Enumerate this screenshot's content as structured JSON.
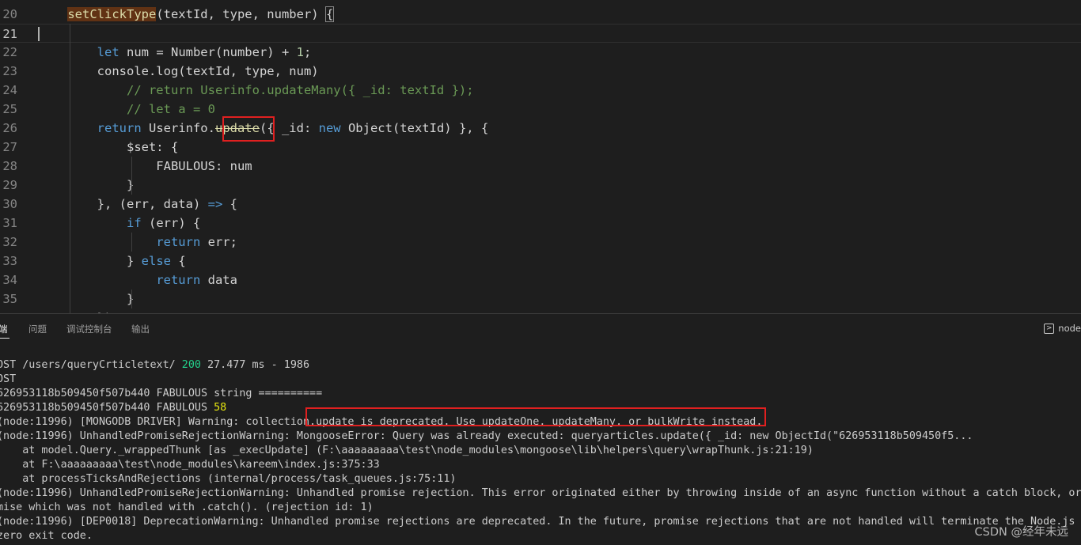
{
  "editor": {
    "lines": [
      {
        "num": "20",
        "tokens": [
          {
            "t": "    "
          },
          {
            "t": "setClickType",
            "c": "fn-hl"
          },
          {
            "t": "(textId, type, number) "
          },
          {
            "t": "{",
            "c": "brace-hl"
          }
        ]
      },
      {
        "num": "21",
        "current": true,
        "tokens": []
      },
      {
        "num": "22",
        "tokens": [
          {
            "t": "        "
          },
          {
            "t": "let",
            "c": "kw"
          },
          {
            "t": " num = "
          },
          {
            "t": "Number",
            "c": "id"
          },
          {
            "t": "(number) + "
          },
          {
            "t": "1",
            "c": "nm"
          },
          {
            "t": ";"
          }
        ]
      },
      {
        "num": "23",
        "tokens": [
          {
            "t": "        console.log(textId, type, num)"
          }
        ]
      },
      {
        "num": "24",
        "tokens": [
          {
            "t": "            "
          },
          {
            "t": "// return Userinfo.updateMany({ _id: textId });",
            "c": "cm"
          }
        ]
      },
      {
        "num": "25",
        "tokens": [
          {
            "t": "            "
          },
          {
            "t": "// let a = 0",
            "c": "cm"
          }
        ]
      },
      {
        "num": "26",
        "tokens": [
          {
            "t": "        "
          },
          {
            "t": "return",
            "c": "kw"
          },
          {
            "t": " Userinfo."
          },
          {
            "t": "update",
            "c": "strike"
          },
          {
            "t": "({ _id: "
          },
          {
            "t": "new",
            "c": "kw"
          },
          {
            "t": " Object(textId) }, {"
          }
        ]
      },
      {
        "num": "27",
        "tokens": [
          {
            "t": "            $set: {"
          }
        ]
      },
      {
        "num": "28",
        "tokens": [
          {
            "t": "                FABULOUS: num"
          }
        ]
      },
      {
        "num": "29",
        "tokens": [
          {
            "t": "            }"
          }
        ]
      },
      {
        "num": "30",
        "tokens": [
          {
            "t": "        }, (err, data) "
          },
          {
            "t": "=>",
            "c": "kw"
          },
          {
            "t": " {"
          }
        ]
      },
      {
        "num": "31",
        "tokens": [
          {
            "t": "            "
          },
          {
            "t": "if",
            "c": "kw"
          },
          {
            "t": " (err) {"
          }
        ]
      },
      {
        "num": "32",
        "tokens": [
          {
            "t": "                "
          },
          {
            "t": "return",
            "c": "kw"
          },
          {
            "t": " err;"
          }
        ]
      },
      {
        "num": "33",
        "tokens": [
          {
            "t": "            } "
          },
          {
            "t": "else",
            "c": "kw"
          },
          {
            "t": " {"
          }
        ]
      },
      {
        "num": "34",
        "tokens": [
          {
            "t": "                "
          },
          {
            "t": "return",
            "c": "kw"
          },
          {
            "t": " data"
          }
        ]
      },
      {
        "num": "35",
        "tokens": [
          {
            "t": "            }"
          }
        ]
      },
      {
        "num": "",
        "tokens": [
          {
            "t": "        })"
          }
        ]
      }
    ]
  },
  "panel": {
    "tabs": [
      "端",
      "问题",
      "调试控制台",
      "输出"
    ],
    "active_tab": 0,
    "terminal_selector": "node"
  },
  "terminal": {
    "lines": [
      {
        "tokens": [
          {
            "t": "OST /users/queryCrticletext/ "
          },
          {
            "t": "200",
            "c": "t-green"
          },
          {
            "t": " 27.477 ms - 1986"
          }
        ]
      },
      {
        "tokens": [
          {
            "t": "OST"
          }
        ]
      },
      {
        "tokens": [
          {
            "t": "626953118b509450f507b440 FABULOUS string =========="
          }
        ]
      },
      {
        "tokens": [
          {
            "t": "626953118b509450f507b440 FABULOUS "
          },
          {
            "t": "58",
            "c": "t-yellow"
          }
        ]
      },
      {
        "tokens": [
          {
            "t": "(node:11996) [MONGODB DRIVER] Warning: collection.update is deprecated. Use updateOne, updateMany, or bulkWrite instead."
          }
        ]
      },
      {
        "tokens": [
          {
            "t": "(node:11996) UnhandledPromiseRejectionWarning: MongooseError: Query was already executed: queryarticles.update({ _id: new ObjectId(\"626953118b509450f5..."
          }
        ]
      },
      {
        "tokens": [
          {
            "t": "    at model.Query._wrappedThunk [as _execUpdate] (F:\\aaaaaaaaa\\test\\node_modules\\mongoose\\lib\\helpers\\query\\wrapThunk.js:21:19)"
          }
        ]
      },
      {
        "tokens": [
          {
            "t": "    at F:\\aaaaaaaaa\\test\\node_modules\\kareem\\index.js:375:33"
          }
        ]
      },
      {
        "tokens": [
          {
            "t": "    at processTicksAndRejections (internal/process/task_queues.js:75:11)"
          }
        ]
      },
      {
        "tokens": [
          {
            "t": "(node:11996) UnhandledPromiseRejectionWarning: Unhandled promise rejection. This error originated either by throwing inside of an async function without a catch block, or by"
          }
        ]
      },
      {
        "tokens": [
          {
            "t": "mise which was not handled with .catch(). (rejection id: 1)"
          }
        ]
      },
      {
        "tokens": [
          {
            "t": "(node:11996) [DEP0018] DeprecationWarning: Unhandled promise rejections are deprecated. In the future, promise rejections that are not handled will terminate the Node.js pro"
          }
        ]
      },
      {
        "tokens": [
          {
            "t": "zero exit code."
          }
        ]
      },
      {
        "tokens": [
          {
            "t": "…"
          }
        ]
      }
    ]
  },
  "watermark": "CSDN @经年未远",
  "colors": {
    "highlight_box": "#e02020",
    "keyword": "#569cd6",
    "comment": "#6a9955",
    "function": "#dcdcaa"
  }
}
